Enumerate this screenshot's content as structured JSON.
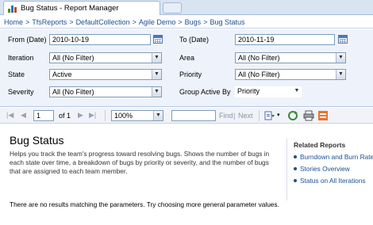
{
  "window": {
    "tab_title": "Bug Status - Report Manager"
  },
  "breadcrumb": [
    "Home",
    "TfsReports",
    "DefaultCollection",
    "Agile Demo",
    "Bugs",
    "Bug Status"
  ],
  "breadcrumb_separator": ">",
  "parameters": {
    "from_date": {
      "label": "From (Date)",
      "value": "2010-10-19"
    },
    "to_date": {
      "label": "To (Date)",
      "value": "2010-11-19"
    },
    "iteration": {
      "label": "Iteration",
      "value": "All (No Filter)"
    },
    "area": {
      "label": "Area",
      "value": "All (No Filter)"
    },
    "state": {
      "label": "State",
      "value": "Active"
    },
    "priority": {
      "label": "Priority",
      "value": "All (No Filter)"
    },
    "severity": {
      "label": "Severity",
      "value": "All (No Filter)"
    },
    "group_active_by": {
      "label": "Group Active By",
      "value": "Priority"
    }
  },
  "toolbar": {
    "page_value": "1",
    "of_label": "of 1",
    "zoom_value": "100%",
    "search_placeholder": "",
    "find_label": "Find",
    "separator": "|",
    "next_label": "Next"
  },
  "report": {
    "title": "Bug Status",
    "description": "Helps you track the team's progress toward resolving bugs. Shows the number of bugs in each state over time, a breakdown of bugs by priority or severity, and the number of bugs that are assigned to each team member.",
    "related_title": "Related Reports",
    "related_links": [
      "Burndown and Burn Rate",
      "Stories Overview",
      "Status on All Iterations"
    ],
    "message": "There are no results matching the parameters. Try choosing more general parameter values."
  },
  "colors": {
    "link": "#1c4e94",
    "param_bg": "#eef2fa",
    "tab_bg": "#d9e4f3"
  }
}
